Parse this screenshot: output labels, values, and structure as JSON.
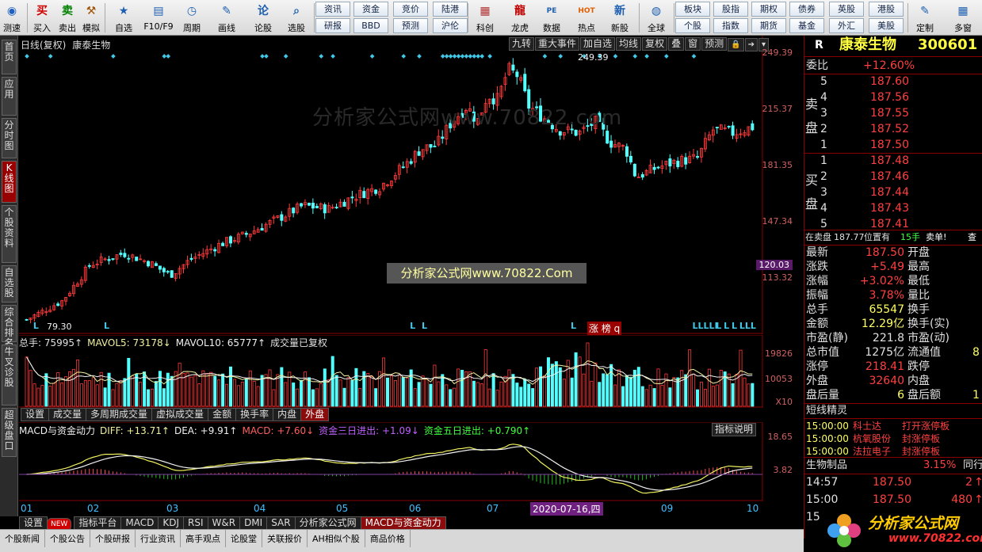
{
  "toolbar": {
    "groups": [
      {
        "label": "测速",
        "icon": "speed-test-icon",
        "glyph": "◉",
        "color": "#2060c0",
        "style": "big"
      },
      {
        "label": "买入",
        "icon": "buy-icon",
        "glyph": "买",
        "color": "#d00000",
        "style": "big"
      },
      {
        "label": "卖出",
        "icon": "sell-icon",
        "glyph": "卖",
        "color": "#008000",
        "style": "big"
      },
      {
        "label": "模拟",
        "icon": "hammer-icon",
        "glyph": "⚒",
        "color": "#a05000",
        "style": "big"
      },
      {
        "label": "自选",
        "icon": "star-icon",
        "glyph": "★",
        "color": "#1e5fb0",
        "style": "big"
      },
      {
        "label": "F10/F9",
        "icon": "f10-icon",
        "glyph": "▤",
        "color": "#1e5fb0",
        "style": "big"
      },
      {
        "label": "周期",
        "icon": "clock-icon",
        "glyph": "◷",
        "color": "#1e5fb0",
        "style": "big"
      },
      {
        "label": "画线",
        "icon": "pencil-icon",
        "glyph": "✎",
        "color": "#1e5fb0",
        "style": "big"
      },
      {
        "label": "论股",
        "icon": "discuss-icon",
        "glyph": "论",
        "color": "#1e5fb0",
        "style": "big"
      },
      {
        "label": "选股",
        "icon": "magnifier-icon",
        "glyph": "⌕",
        "color": "#1e5fb0",
        "style": "big"
      },
      {
        "label": "科创",
        "icon": "sci-tech-icon",
        "glyph": "▦",
        "color": "#b03030",
        "style": "big"
      },
      {
        "label": "龙虎",
        "icon": "dragon-tiger-icon",
        "glyph": "龍",
        "color": "#c00000",
        "style": "big"
      },
      {
        "label": "数据",
        "icon": "pe-icon",
        "glyph": "PE",
        "color": "#1e5fb0",
        "style": "big"
      },
      {
        "label": "热点",
        "icon": "hot-icon",
        "glyph": "HOT",
        "color": "#e06000",
        "style": "big"
      },
      {
        "label": "新股",
        "icon": "new-stock-icon",
        "glyph": "新",
        "color": "#1e5fb0",
        "style": "big"
      },
      {
        "label": "全球",
        "icon": "globe-icon",
        "glyph": "◍",
        "color": "#1e5fb0",
        "style": "big"
      },
      {
        "label": "定制",
        "icon": "customize-icon",
        "glyph": "✎",
        "color": "#1e5fb0",
        "style": "big"
      },
      {
        "label": "多窗",
        "icon": "multi-window-icon",
        "glyph": "▦",
        "color": "#1e5fb0",
        "style": "big"
      }
    ],
    "small": [
      [
        "资讯",
        "研报"
      ],
      [
        "资金",
        "BBD"
      ],
      [
        "竞价",
        "预测"
      ],
      [
        "陆港",
        "沪伦"
      ],
      [
        "板块",
        "个股"
      ],
      [
        "股指",
        "指数"
      ],
      [
        "期权",
        "期货"
      ],
      [
        "债券",
        "基金"
      ],
      [
        "英股",
        "外汇"
      ],
      [
        "港股",
        "美股"
      ]
    ]
  },
  "lefttabs": [
    "首页",
    "应用",
    "分时图",
    "K线图",
    "个股资料",
    "自选股",
    "综合排名",
    "牛叉诊股",
    "超级盘口"
  ],
  "chart": {
    "period": "日线(复权)",
    "name": "康泰生物",
    "tools": [
      "九转",
      "重大事件",
      "加自选",
      "均线",
      "复权",
      "叠",
      "窗",
      "预测"
    ],
    "price_axis": [
      "249.39",
      "215.37",
      "181.35",
      "147.34",
      "113.32"
    ],
    "highlight_price": "120.03",
    "high_label": "249.39",
    "low_label": "79.30",
    "watermark": "分析家公式网www.70822.com",
    "banner": "分析家公式网www.70822.Com",
    "events": "涨 榜 q"
  },
  "volume": {
    "header": [
      {
        "t": "总手: 75995↑",
        "c": "#e0e0e0"
      },
      {
        "t": "MAVOL5: 73178↓",
        "c": "#f0f0a0"
      },
      {
        "t": "MAVOL10: 65777↑",
        "c": "#f0f0f0"
      },
      {
        "t": "成交量已复权",
        "c": "#e0e0e0"
      }
    ],
    "axis": [
      "19826",
      "10053",
      "X10"
    ],
    "tabs": [
      "设置",
      "成交量",
      "多周期成交量",
      "虚拟成交量",
      "金额",
      "换手率",
      "内盘",
      "外盘"
    ]
  },
  "macd": {
    "header": [
      {
        "t": "MACD与资金动力",
        "c": "#f0f0f0"
      },
      {
        "t": "DIFF: +13.71↑",
        "c": "#f0f0a0"
      },
      {
        "t": "DEA: +9.91↑",
        "c": "#f0f0f0"
      },
      {
        "t": "MACD: +7.60↓",
        "c": "#ff6060"
      },
      {
        "t": "资金三日进出: +1.09↓",
        "c": "#c060ff"
      },
      {
        "t": "资金五日进出: +0.790↑",
        "c": "#40ff40"
      }
    ],
    "axis": [
      "18.65",
      "3.82"
    ],
    "explain": "指标说明",
    "months": [
      "01",
      "02",
      "03",
      "04",
      "05",
      "06",
      "07",
      "08",
      "09",
      "10"
    ],
    "cursor_date": "2020-07-16,四"
  },
  "bottom_tabs": {
    "tabs": [
      "设置",
      "NEW",
      "指标平台",
      "MACD",
      "KDJ",
      "RSI",
      "W&R",
      "DMI",
      "SAR",
      "分析家公式网",
      "MACD与资金动力"
    ]
  },
  "status": [
    "个股新闻",
    "个股公告",
    "个股研报",
    "行业资讯",
    "高手观点",
    "论股堂",
    "关联报价",
    "AH相似个股",
    "商品价格"
  ],
  "side": {
    "header": {
      "flag": "R",
      "name": "康泰生物",
      "code": "300601"
    },
    "webi": {
      "label": "委比",
      "value": "+12.60%"
    },
    "sell": [
      {
        "n": "5",
        "p": "187.60"
      },
      {
        "n": "4",
        "p": "187.56"
      },
      {
        "n": "3",
        "p": "187.55"
      },
      {
        "n": "2",
        "p": "187.52"
      },
      {
        "n": "1",
        "p": "187.50"
      }
    ],
    "buy": [
      {
        "n": "1",
        "p": "187.48"
      },
      {
        "n": "2",
        "p": "187.46"
      },
      {
        "n": "3",
        "p": "187.44"
      },
      {
        "n": "4",
        "p": "187.43"
      },
      {
        "n": "5",
        "p": "187.41"
      }
    ],
    "sell_label": "卖盘",
    "buy_label": "买盘",
    "inline": {
      "a": "在卖盘",
      "b": "187.77",
      "c": "位置有",
      "d": "15手",
      "e": "卖单!",
      "f": "查"
    },
    "stats": [
      {
        "l": "最新",
        "v": "187.50",
        "vc": "#ff4040",
        "r": "开盘"
      },
      {
        "l": "涨跌",
        "v": "+5.49",
        "vc": "#ff4040",
        "r": "最高"
      },
      {
        "l": "涨幅",
        "v": "+3.02%",
        "vc": "#ff4040",
        "r": "最低"
      },
      {
        "l": "振幅",
        "v": "3.78%",
        "vc": "#ff4040",
        "r": "量比"
      },
      {
        "l": "总手",
        "v": "65547",
        "vc": "#ffff60",
        "r": "换手"
      },
      {
        "l": "金额",
        "v": "12.29亿",
        "vc": "#ffff60",
        "r": "换手(实)"
      },
      {
        "l": "市盈(静)",
        "v": "221.8",
        "vc": "#e0e0e0",
        "r": "市盈(动)"
      },
      {
        "l": "总市值",
        "v": "1275亿",
        "vc": "#e0e0e0",
        "r": "流通值"
      },
      {
        "l": "涨停",
        "v": "218.41",
        "vc": "#ff4040",
        "r": "跌停"
      },
      {
        "l": "外盘",
        "v": "32640",
        "vc": "#ff4040",
        "r": "内盘"
      },
      {
        "l": "盘后量",
        "v": "6",
        "vc": "#ffff60",
        "r": "盘后额"
      }
    ],
    "stat_extra": [
      "8",
      "1"
    ],
    "sprite_title": "短线精灵",
    "sprite": [
      {
        "t": "15:00:00",
        "n": "科士达",
        "e": "打开涨停板"
      },
      {
        "t": "15:00:00",
        "n": "杭氧股份",
        "e": "封涨停板"
      },
      {
        "t": "15:00:00",
        "n": "法拉电子",
        "e": "封涨停板"
      }
    ],
    "industry": {
      "n": "生物制品",
      "v": "3.15%",
      "r": "同行"
    },
    "ticks": [
      {
        "t": "14:57",
        "p": "187.50",
        "q": "2",
        "s": "↑"
      },
      {
        "t": "15:00",
        "p": "187.50",
        "q": "480",
        "s": "↑"
      },
      {
        "t": "15:00",
        "p": "187.50",
        "q": "",
        "s": ""
      }
    ]
  },
  "logo": {
    "cn": "分析家公式网",
    "url": "www.70822.com"
  },
  "colors": {
    "up": "#ff3a3a",
    "down": "#54ffff",
    "bg": "#000000",
    "grid": "#8a0000"
  }
}
